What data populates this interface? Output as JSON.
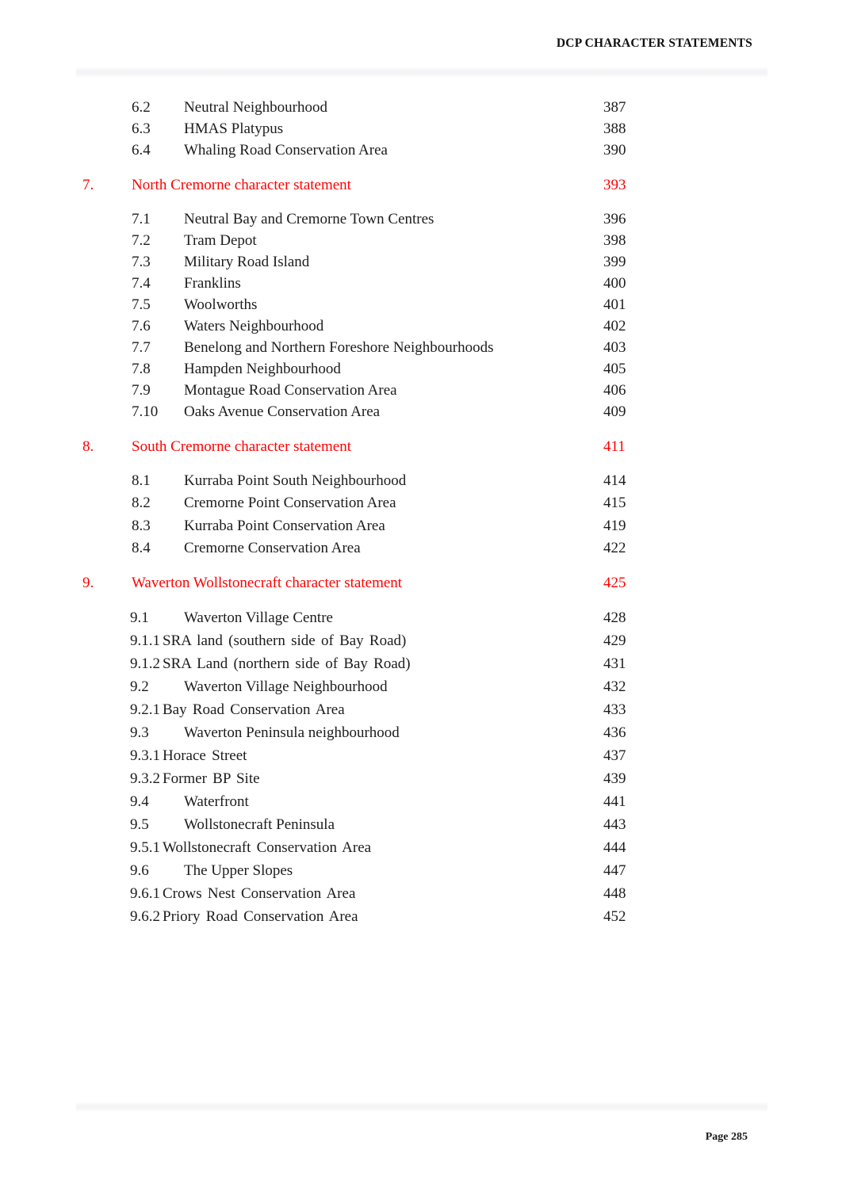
{
  "header": {
    "title": "DCP CHARACTER STATEMENTS"
  },
  "footer": {
    "page_label": "Page 285"
  },
  "colors": {
    "section_heading": "#ff0000",
    "body_text": "#1c1c1c",
    "rule": "#f4f4f6"
  },
  "toc": {
    "entries": [
      {
        "num": "6.2",
        "title": "Neutral Neighbourhood",
        "page": "387",
        "level": "sub",
        "style": ""
      },
      {
        "num": "6.3",
        "title": "HMAS Platypus",
        "page": "388",
        "level": "sub",
        "style": ""
      },
      {
        "num": "6.4",
        "title": "Whaling Road Conservation Area",
        "page": "390",
        "level": "sub",
        "style": ""
      },
      {
        "num": "7.",
        "title": "North Cremorne character statement",
        "page": "393",
        "level": "section",
        "style": ""
      },
      {
        "num": "7.1",
        "title": "Neutral Bay and Cremorne Town Centres",
        "page": "396",
        "level": "sub",
        "style": ""
      },
      {
        "num": "7.2",
        "title": "Tram Depot",
        "page": "398",
        "level": "sub",
        "style": ""
      },
      {
        "num": "7.3",
        "title": "Military Road Island",
        "page": "399",
        "level": "sub",
        "style": ""
      },
      {
        "num": "7.4",
        "title": "Franklins",
        "page": "400",
        "level": "sub",
        "style": ""
      },
      {
        "num": "7.5",
        "title": "Woolworths",
        "page": "401",
        "level": "sub",
        "style": ""
      },
      {
        "num": "7.6",
        "title": "Waters Neighbourhood",
        "page": "402",
        "level": "sub",
        "style": ""
      },
      {
        "num": "7.7",
        "title": "Benelong and Northern Foreshore Neighbourhoods",
        "page": "403",
        "level": "sub",
        "style": ""
      },
      {
        "num": "7.8",
        "title": "Hampden Neighbourhood",
        "page": "405",
        "level": "sub",
        "style": ""
      },
      {
        "num": "7.9",
        "title": "Montague Road Conservation Area",
        "page": "406",
        "level": "sub",
        "style": ""
      },
      {
        "num": "7.10",
        "title": "Oaks Avenue Conservation Area",
        "page": "409",
        "level": "sub",
        "style": ""
      },
      {
        "num": "8.",
        "title": "South Cremorne character statement",
        "page": "411",
        "level": "section",
        "style": ""
      },
      {
        "num": "8.1",
        "title": "Kurraba Point South Neighbourhood",
        "page": "414",
        "level": "sub",
        "style": ""
      },
      {
        "num": "8.2",
        "title": "Cremorne Point Conservation Area",
        "page": "415",
        "level": "sub",
        "style": "loose"
      },
      {
        "num": "8.3",
        "title": "Kurraba Point Conservation Area",
        "page": "419",
        "level": "sub",
        "style": "loose"
      },
      {
        "num": "8.4",
        "title": "Cremorne Conservation Area",
        "page": "422",
        "level": "sub",
        "style": ""
      },
      {
        "num": "9.",
        "title": "Waverton Wollstonecraft character statement",
        "page": "425",
        "level": "section",
        "style": ""
      },
      {
        "num": "9.1",
        "title": "Waverton Village Centre",
        "page": "428",
        "level": "lvl2-9",
        "style": "loose"
      },
      {
        "num": "9.1.1",
        "title": "SRA land (southern side of Bay Road)",
        "page": "429",
        "level": "deep",
        "style": "loose"
      },
      {
        "num": "9.1.2",
        "title": "SRA Land (northern side of Bay Road)",
        "page": "431",
        "level": "deep",
        "style": "loose"
      },
      {
        "num": "9.2",
        "title": "Waverton Village Neighbourhood",
        "page": "432",
        "level": "lvl2-9",
        "style": "loose"
      },
      {
        "num": "9.2.1",
        "title": "Bay Road Conservation Area",
        "page": "433",
        "level": "deep",
        "style": "loose"
      },
      {
        "num": "9.3",
        "title": "Waverton Peninsula neighbourhood",
        "page": "436",
        "level": "lvl2-9",
        "style": "loose"
      },
      {
        "num": "9.3.1",
        "title": "Horace Street",
        "page": "437",
        "level": "deep",
        "style": "loose"
      },
      {
        "num": "9.3.2",
        "title": "Former BP Site",
        "page": "439",
        "level": "deep",
        "style": "loose"
      },
      {
        "num": "9.4",
        "title": "Waterfront",
        "page": "441",
        "level": "lvl2-9",
        "style": "loose"
      },
      {
        "num": "9.5",
        "title": "Wollstonecraft Peninsula",
        "page": "443",
        "level": "lvl2-9",
        "style": "loose"
      },
      {
        "num": "9.5.1",
        "title": "Wollstonecraft Conservation Area",
        "page": "444",
        "level": "deep",
        "style": "loose"
      },
      {
        "num": "9.6",
        "title": "The Upper Slopes",
        "page": "447",
        "level": "lvl2-9",
        "style": "loose"
      },
      {
        "num": "9.6.1",
        "title": "Crows Nest Conservation Area",
        "page": "448",
        "level": "deep",
        "style": "loose"
      },
      {
        "num": "9.6.2",
        "title": "Priory Road Conservation Area",
        "page": "452",
        "level": "deep",
        "style": "loose"
      }
    ]
  }
}
